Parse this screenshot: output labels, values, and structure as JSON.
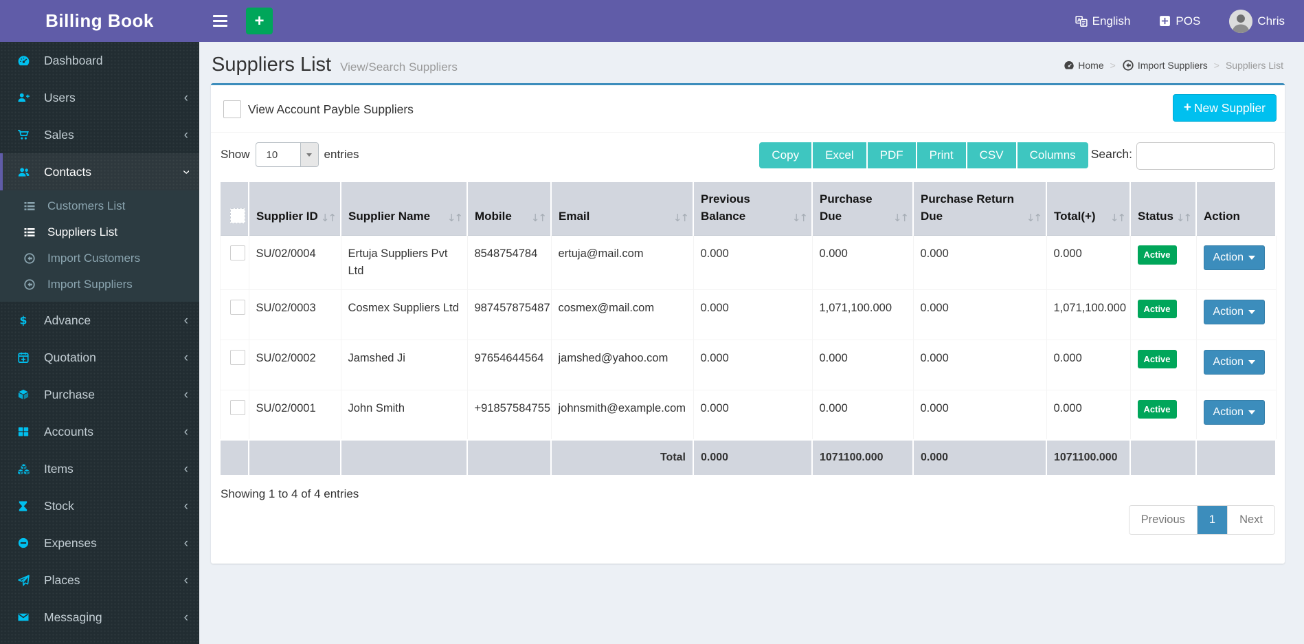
{
  "colors": {
    "topbar_purple": "#605ca8",
    "sidebar_dark": "#222d32",
    "icon_cyan": "#00c0ef",
    "teal_button": "#3ec6c0",
    "primary_blue": "#3c8dbc",
    "success_green": "#00a65a",
    "new_supplier_cyan": "#00c0ef",
    "table_header_gray": "#d2d6de"
  },
  "topbar": {
    "brand": "Billing Book",
    "language_label": "English",
    "pos_label": "POS",
    "user_name": "Chris"
  },
  "sidebar": {
    "items": [
      {
        "label": "Dashboard",
        "icon": "dashboard-icon",
        "chevron": null,
        "active": false
      },
      {
        "label": "Users",
        "icon": "user-plus-icon",
        "chevron": "left",
        "active": false
      },
      {
        "label": "Sales",
        "icon": "cart-icon",
        "chevron": "left",
        "active": false
      },
      {
        "label": "Contacts",
        "icon": "group-icon",
        "chevron": "down",
        "active": true,
        "children": [
          {
            "label": "Customers List",
            "icon": "list-icon",
            "active": false
          },
          {
            "label": "Suppliers List",
            "icon": "list-icon",
            "active": true
          },
          {
            "label": "Import Customers",
            "icon": "import-circle-icon",
            "active": false
          },
          {
            "label": "Import Suppliers",
            "icon": "import-circle-icon",
            "active": false
          }
        ]
      },
      {
        "label": "Advance",
        "icon": "dollar-icon",
        "chevron": "left",
        "active": false
      },
      {
        "label": "Quotation",
        "icon": "calendar-plus-icon",
        "chevron": "left",
        "active": false
      },
      {
        "label": "Purchase",
        "icon": "cube-icon",
        "chevron": "left",
        "active": false
      },
      {
        "label": "Accounts",
        "icon": "grid-icon",
        "chevron": "left",
        "active": false
      },
      {
        "label": "Items",
        "icon": "cubes-icon",
        "chevron": "left",
        "active": false
      },
      {
        "label": "Stock",
        "icon": "hourglass-icon",
        "chevron": "left",
        "active": false
      },
      {
        "label": "Expenses",
        "icon": "minus-circle-icon",
        "chevron": "left",
        "active": false
      },
      {
        "label": "Places",
        "icon": "paper-plane-icon",
        "chevron": "left",
        "active": false
      },
      {
        "label": "Messaging",
        "icon": "envelope-icon",
        "chevron": "left",
        "active": false
      }
    ]
  },
  "page_header": {
    "title": "Suppliers List",
    "subtitle": "View/Search Suppliers",
    "breadcrumb": [
      {
        "label": "Home",
        "icon": "home-icon",
        "current": false
      },
      {
        "label": "Import Suppliers",
        "icon": "import-circle-icon",
        "current": false
      },
      {
        "label": "Suppliers List",
        "icon": null,
        "current": true
      }
    ]
  },
  "panel": {
    "filter_checkbox_label": "View Account Payble Suppliers",
    "filter_checkbox_checked": false,
    "new_supplier_label": "New Supplier",
    "show_label": "Show",
    "entries_label": "entries",
    "page_size": "10",
    "export_buttons": [
      "Copy",
      "Excel",
      "PDF",
      "Print",
      "CSV",
      "Columns"
    ],
    "search_label": "Search:",
    "search_value": "",
    "table": {
      "columns": [
        {
          "label": "",
          "sortable": false
        },
        {
          "label": "Supplier ID",
          "sortable": true
        },
        {
          "label": "Supplier Name",
          "sortable": true
        },
        {
          "label": "Mobile",
          "sortable": true
        },
        {
          "label": "Email",
          "sortable": true
        },
        {
          "label": "Previous Balance",
          "sortable": true
        },
        {
          "label": "Purchase Due",
          "sortable": true
        },
        {
          "label": "Purchase Return Due",
          "sortable": true
        },
        {
          "label": "Total(+)",
          "sortable": true
        },
        {
          "label": "Status",
          "sortable": true
        },
        {
          "label": "Action",
          "sortable": false
        }
      ],
      "rows": [
        {
          "supplier_id": "SU/02/0004",
          "supplier_name": "Ertuja Suppliers Pvt Ltd",
          "mobile": "8548754784",
          "email": "ertuja@mail.com",
          "previous_balance": "0.000",
          "purchase_due": "0.000",
          "purchase_return_due": "0.000",
          "total": "0.000",
          "status": "Active",
          "action_label": "Action"
        },
        {
          "supplier_id": "SU/02/0003",
          "supplier_name": "Cosmex Suppliers Ltd",
          "mobile": "987457875487",
          "email": "cosmex@mail.com",
          "previous_balance": "0.000",
          "purchase_due": "1,071,100.000",
          "purchase_return_due": "0.000",
          "total": "1,071,100.000",
          "status": "Active",
          "action_label": "Action"
        },
        {
          "supplier_id": "SU/02/0002",
          "supplier_name": "Jamshed Ji",
          "mobile": "97654644564",
          "email": "jamshed@yahoo.com",
          "previous_balance": "0.000",
          "purchase_due": "0.000",
          "purchase_return_due": "0.000",
          "total": "0.000",
          "status": "Active",
          "action_label": "Action"
        },
        {
          "supplier_id": "SU/02/0001",
          "supplier_name": "John Smith",
          "mobile": "+91857584755",
          "email": "johnsmith@example.com",
          "previous_balance": "0.000",
          "purchase_due": "0.000",
          "purchase_return_due": "0.000",
          "total": "0.000",
          "status": "Active",
          "action_label": "Action"
        }
      ],
      "footer": {
        "label": "Total",
        "previous_balance": "0.000",
        "purchase_due": "1071100.000",
        "purchase_return_due": "0.000",
        "total": "1071100.000"
      }
    },
    "info": "Showing 1 to 4 of 4 entries",
    "pagination": {
      "previous_label": "Previous",
      "pages": [
        "1"
      ],
      "active_page": "1",
      "next_label": "Next"
    }
  }
}
